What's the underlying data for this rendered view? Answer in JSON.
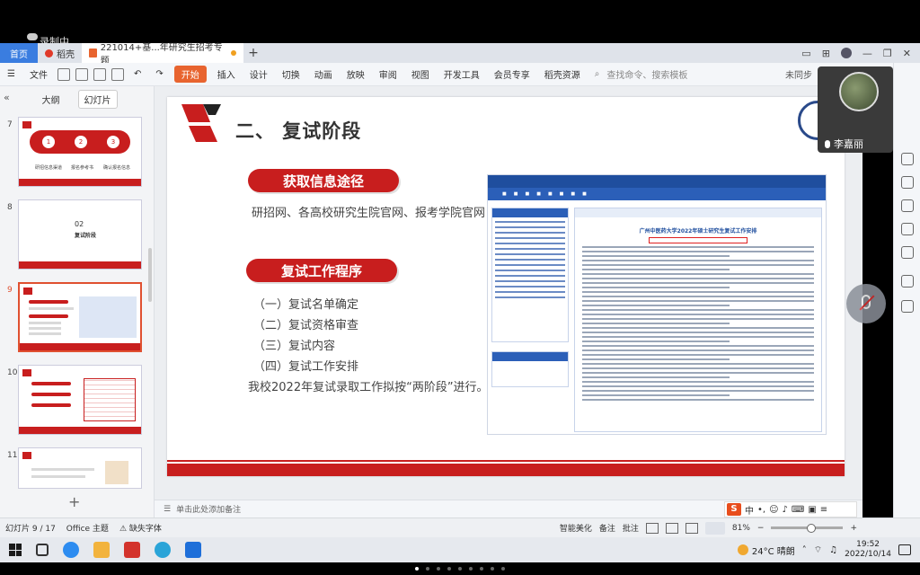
{
  "recorder": {
    "label": "录制中"
  },
  "tabs": {
    "home": "首页",
    "wps": "稻壳",
    "doc": "221014+基...年研究生招考专题",
    "plus": "+"
  },
  "toolbar": {
    "file": "文件",
    "start": "开始",
    "items": [
      "插入",
      "设计",
      "切换",
      "动画",
      "放映",
      "审阅",
      "视图",
      "开发工具",
      "会员专享",
      "稻壳资源"
    ],
    "search": "查找命令、搜索模板",
    "sync": "未同步"
  },
  "leftpanel": {
    "tab_outline": "大纲",
    "tab_slides": "幻灯片",
    "slides": [
      {
        "num": "7",
        "captions": [
          "研招信息渠道",
          "报名参考书",
          "确认报名信息"
        ]
      },
      {
        "num": "8",
        "title": "02",
        "subtitle": "复试阶段"
      },
      {
        "num": "9"
      },
      {
        "num": "10"
      },
      {
        "num": "11"
      }
    ],
    "add": "+"
  },
  "slide": {
    "title": "二、 复试阶段",
    "pill1": "获取信息途径",
    "line1": "研招网、各高校研究生院官网、报考学院官网",
    "pill2": "复试工作程序",
    "steps": [
      "（一）复试名单确定",
      "（二）复试资格审查",
      "（三）复试内容",
      "（四）复试工作安排"
    ],
    "summary": "我校2022年复试录取工作拟按“两阶段”进行。",
    "web_title": "广州中医药大学2022年硕士研究生复试工作安排"
  },
  "notes": {
    "placeholder": "单击此处添加备注"
  },
  "status": {
    "slide_count": "幻灯片 9 / 17",
    "theme": "Office 主题",
    "font_missing": "缺失字体",
    "smart": "智能美化",
    "notes": "备注",
    "comment": "批注",
    "zoom": "81%"
  },
  "video": {
    "name": "李嘉丽"
  },
  "ime": {
    "logo": "S",
    "lang": "中"
  },
  "taskbar": {
    "weather": "24°C 晴朗",
    "time": "19:52",
    "date": "2022/10/14"
  },
  "colors": {
    "brand_red": "#c81e1e",
    "start_orange": "#e8642f",
    "home_blue": "#3a7de0"
  }
}
